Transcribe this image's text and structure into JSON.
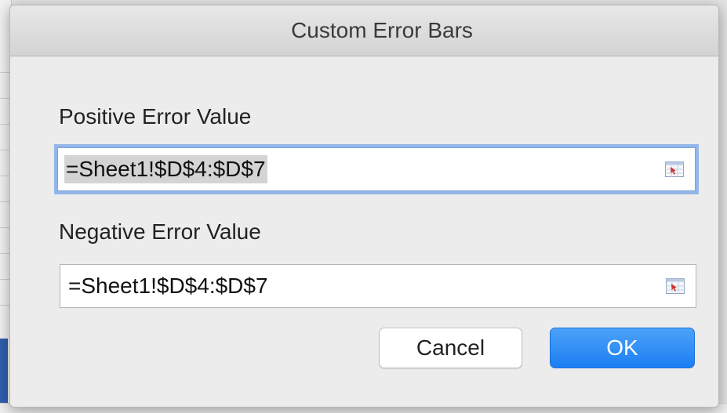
{
  "dialog": {
    "title": "Custom Error Bars",
    "positive": {
      "label": "Positive Error Value",
      "value": "=Sheet1!$D$4:$D$7",
      "icon": "range-selector-icon"
    },
    "negative": {
      "label": "Negative Error Value",
      "value": "=Sheet1!$D$4:$D$7",
      "icon": "range-selector-icon"
    },
    "buttons": {
      "cancel": "Cancel",
      "ok": "OK"
    }
  },
  "colors": {
    "focus_ring": "#93b7ea",
    "ok_button": "#1b7ef2"
  }
}
